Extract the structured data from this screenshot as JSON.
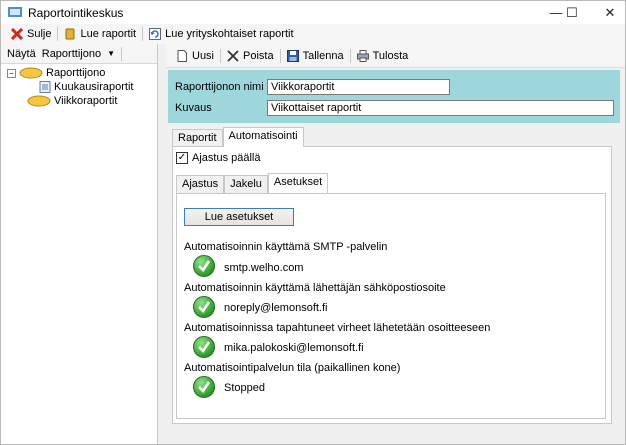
{
  "window": {
    "title": "Raportointikeskus",
    "minimize": "—",
    "maximize": "☐",
    "close": "✕"
  },
  "toolbar": {
    "close_label": "Sulje",
    "read_reports_label": "Lue raportit",
    "company_reports_label": "Lue yrityskohtaiset raportit"
  },
  "left": {
    "show_label": "Näytä",
    "queue_dropdown": "Raporttijono",
    "tree": {
      "root": "Raporttijono",
      "children": [
        "Kuukausiraportit",
        "Viikkoraportit"
      ]
    }
  },
  "right_toolbar": {
    "new": "Uusi",
    "delete": "Poista",
    "save": "Tallenna",
    "print": "Tulosta"
  },
  "header": {
    "name_label": "Raporttijonon nimi",
    "name_value": "Viikkoraportit",
    "desc_label": "Kuvaus",
    "desc_value": "Viikottaiset raportit"
  },
  "tabs": [
    "Raportit",
    "Automatisointi"
  ],
  "automation": {
    "schedule_on_label": "Ajastus päällä",
    "subtabs": [
      "Ajastus",
      "Jakelu",
      "Asetukset"
    ],
    "read_settings_button": "Lue asetukset",
    "items": [
      {
        "label": "Automatisoinnin käyttämä SMTP -palvelin",
        "value": "smtp.welho.com"
      },
      {
        "label": "Automatisoinnin käyttämä lähettäjän sähköpostiosoite",
        "value": "noreply@lemonsoft.fi"
      },
      {
        "label": "Automatisoinnissa tapahtuneet virheet lähetetään osoitteeseen",
        "value": "mika.palokoski@lemonsoft.fi"
      },
      {
        "label": "Automatisointipalvelun tila (paikallinen kone)",
        "value": "Stopped"
      }
    ]
  }
}
